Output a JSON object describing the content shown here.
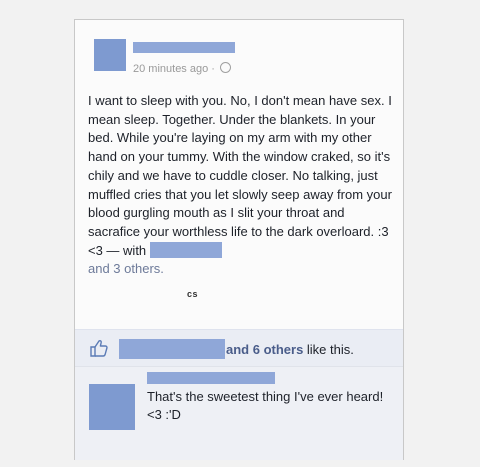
{
  "post": {
    "timestamp": "20 minutes ago ·",
    "privacy_icon": "globe-icon",
    "text": "I want to sleep with you. No, I don't mean have sex. I mean sleep. Together. Under the blankets. In your bed. While you're laying on my arm with my other hand on your tummy. With the window craked, so it's chily and we have to cuddle closer. No talking, just muffled cries that you let slowly seep away from your blood gurgling mouth as I slit your throat and sacrafice your worthless life to the dark overloard. :3 <3 — with",
    "and_others": "and 3 others.",
    "watermark": "cs"
  },
  "likes": {
    "icon": "thumbs-up-icon",
    "bold_text": "and 6 others",
    "suffix": " like this."
  },
  "comment": {
    "text": "That's the sweetest thing I've ever heard! <3 :'D"
  },
  "colors": {
    "redaction": "#8fa7d8",
    "avatar": "#7e9ad0",
    "like_bar": "#eaedf4",
    "comment_bg": "#eef0f5"
  }
}
